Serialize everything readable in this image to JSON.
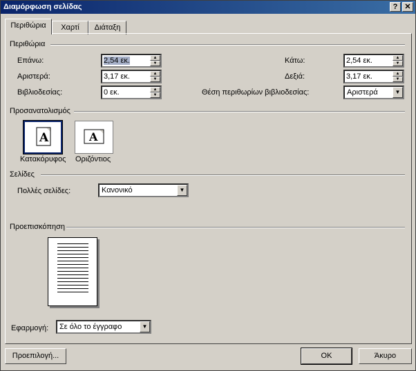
{
  "window": {
    "title": "Διαμόρφωση σελίδας",
    "help_label": "?",
    "close_label": "✕"
  },
  "tabs": [
    {
      "label": "Περιθώρια",
      "active": true
    },
    {
      "label": "Χαρτί",
      "active": false
    },
    {
      "label": "Διάταξη",
      "active": false
    }
  ],
  "margins": {
    "group_label": "Περιθώρια",
    "top": {
      "label": "Επάνω:",
      "value": "2,54 εκ."
    },
    "bottom": {
      "label": "Κάτω:",
      "value": "2,54 εκ."
    },
    "left": {
      "label": "Αριστερά:",
      "value": "3,17 εκ."
    },
    "right": {
      "label": "Δεξιά:",
      "value": "3,17 εκ."
    },
    "gutter": {
      "label": "Βιβλιοδεσίας:",
      "value": "0 εκ."
    },
    "gutter_position": {
      "label": "Θέση περιθωρίων βιβλιοδεσίας:",
      "value": "Αριστερά"
    }
  },
  "orientation": {
    "group_label": "Προσανατολισμός",
    "portrait": {
      "label": "Κατακόρυφος",
      "glyph": "A",
      "selected": true
    },
    "landscape": {
      "label": "Οριζόντιος",
      "glyph": "A",
      "selected": false
    }
  },
  "pages": {
    "group_label": "Σελίδες",
    "multiple_label": "Πολλές σελίδες:",
    "multiple_value": "Κανονικό"
  },
  "preview": {
    "group_label": "Προεπισκόπηση"
  },
  "apply": {
    "label": "Εφαρμογή:",
    "value": "Σε όλο το έγγραφο"
  },
  "buttons": {
    "default": "Προεπιλογή...",
    "ok": "OK",
    "cancel": "Άκυρο"
  },
  "colors": {
    "titlebar_start": "#0a246a",
    "titlebar_end": "#3a6ea5",
    "face": "#d4d0c8"
  }
}
